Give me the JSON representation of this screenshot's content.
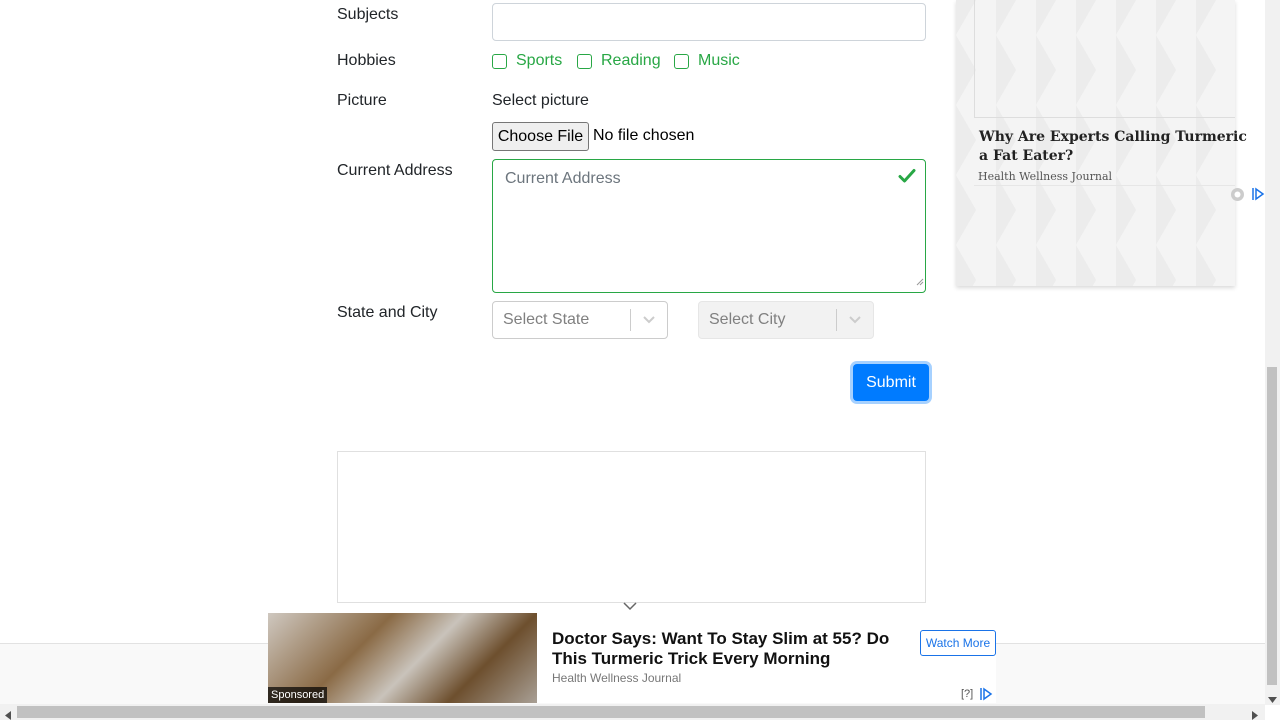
{
  "form": {
    "subjects_label": "Subjects",
    "hobbies_label": "Hobbies",
    "hobbies": [
      "Sports",
      "Reading",
      "Music"
    ],
    "picture_label": "Picture",
    "select_picture": "Select picture",
    "file_button": "Choose File",
    "file_status": "No file chosen",
    "address_label": "Current Address",
    "address_placeholder": "Current Address",
    "state_city_label": "State and City",
    "state_placeholder": "Select State",
    "city_placeholder": "Select City",
    "submit_label": "Submit"
  },
  "side_ad": {
    "title": "Why Are Experts Calling Turmeric a Fat Eater?",
    "source": "Health Wellness Journal"
  },
  "bottom_ad": {
    "sponsored": "Sponsored",
    "title": "Doctor Says: Want To Stay Slim at 55? Do This Turmeric Trick Every Morning",
    "source": "Health Wellness Journal",
    "cta": "Watch More",
    "info": "[?]"
  },
  "colors": {
    "accent": "#007bff",
    "valid": "#28a745"
  }
}
